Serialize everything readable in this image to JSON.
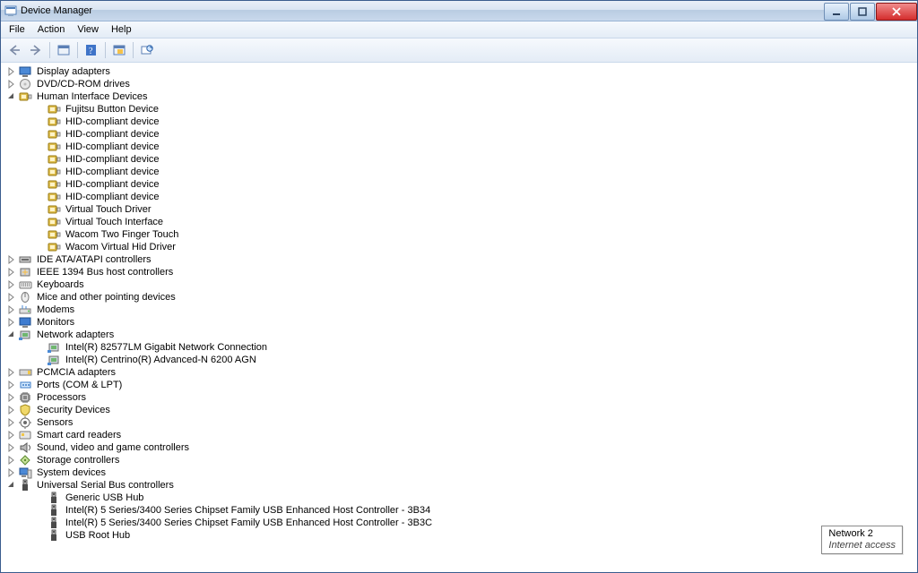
{
  "title": "Device Manager",
  "menu": [
    "File",
    "Action",
    "View",
    "Help"
  ],
  "tooltip": {
    "l1": "Network 2",
    "l2": "Internet access"
  },
  "tree": [
    {
      "d": 1,
      "exp": "closed",
      "icon": "display",
      "label": "Display adapters"
    },
    {
      "d": 1,
      "exp": "closed",
      "icon": "dvd",
      "label": "DVD/CD-ROM drives"
    },
    {
      "d": 1,
      "exp": "open",
      "icon": "hid",
      "label": "Human Interface Devices"
    },
    {
      "d": 2,
      "exp": "leaf",
      "icon": "hidi",
      "label": "Fujitsu Button Device"
    },
    {
      "d": 2,
      "exp": "leaf",
      "icon": "hidi",
      "label": "HID-compliant device"
    },
    {
      "d": 2,
      "exp": "leaf",
      "icon": "hidi",
      "label": "HID-compliant device"
    },
    {
      "d": 2,
      "exp": "leaf",
      "icon": "hidi",
      "label": "HID-compliant device"
    },
    {
      "d": 2,
      "exp": "leaf",
      "icon": "hidi",
      "label": "HID-compliant device"
    },
    {
      "d": 2,
      "exp": "leaf",
      "icon": "hidi",
      "label": "HID-compliant device"
    },
    {
      "d": 2,
      "exp": "leaf",
      "icon": "hidi",
      "label": "HID-compliant device"
    },
    {
      "d": 2,
      "exp": "leaf",
      "icon": "hidi",
      "label": "HID-compliant device"
    },
    {
      "d": 2,
      "exp": "leaf",
      "icon": "hidi",
      "label": "Virtual Touch Driver"
    },
    {
      "d": 2,
      "exp": "leaf",
      "icon": "hidi",
      "label": "Virtual Touch Interface"
    },
    {
      "d": 2,
      "exp": "leaf",
      "icon": "hidi",
      "label": "Wacom Two Finger Touch"
    },
    {
      "d": 2,
      "exp": "leaf",
      "icon": "hidi",
      "label": "Wacom Virtual Hid Driver"
    },
    {
      "d": 1,
      "exp": "closed",
      "icon": "ide",
      "label": "IDE ATA/ATAPI controllers"
    },
    {
      "d": 1,
      "exp": "closed",
      "icon": "ieee",
      "label": "IEEE 1394 Bus host controllers"
    },
    {
      "d": 1,
      "exp": "closed",
      "icon": "keyboard",
      "label": "Keyboards"
    },
    {
      "d": 1,
      "exp": "closed",
      "icon": "mouse",
      "label": "Mice and other pointing devices"
    },
    {
      "d": 1,
      "exp": "closed",
      "icon": "modem",
      "label": "Modems"
    },
    {
      "d": 1,
      "exp": "closed",
      "icon": "monitor",
      "label": "Monitors"
    },
    {
      "d": 1,
      "exp": "open",
      "icon": "net",
      "label": "Network adapters"
    },
    {
      "d": 2,
      "exp": "leaf",
      "icon": "neti",
      "label": "Intel(R) 82577LM Gigabit Network Connection"
    },
    {
      "d": 2,
      "exp": "leaf",
      "icon": "neti",
      "label": "Intel(R) Centrino(R) Advanced-N 6200 AGN"
    },
    {
      "d": 1,
      "exp": "closed",
      "icon": "pcmcia",
      "label": "PCMCIA adapters"
    },
    {
      "d": 1,
      "exp": "closed",
      "icon": "port",
      "label": "Ports (COM & LPT)"
    },
    {
      "d": 1,
      "exp": "closed",
      "icon": "cpu",
      "label": "Processors"
    },
    {
      "d": 1,
      "exp": "closed",
      "icon": "security",
      "label": "Security Devices"
    },
    {
      "d": 1,
      "exp": "closed",
      "icon": "sensor",
      "label": "Sensors"
    },
    {
      "d": 1,
      "exp": "closed",
      "icon": "smartcard",
      "label": "Smart card readers"
    },
    {
      "d": 1,
      "exp": "closed",
      "icon": "sound",
      "label": "Sound, video and game controllers"
    },
    {
      "d": 1,
      "exp": "closed",
      "icon": "storage",
      "label": "Storage controllers"
    },
    {
      "d": 1,
      "exp": "closed",
      "icon": "system",
      "label": "System devices"
    },
    {
      "d": 1,
      "exp": "open",
      "icon": "usb",
      "label": "Universal Serial Bus controllers"
    },
    {
      "d": 2,
      "exp": "leaf",
      "icon": "usbi",
      "label": "Generic USB Hub"
    },
    {
      "d": 2,
      "exp": "leaf",
      "icon": "usbi",
      "label": "Intel(R) 5 Series/3400 Series Chipset Family USB Enhanced Host Controller - 3B34"
    },
    {
      "d": 2,
      "exp": "leaf",
      "icon": "usbi",
      "label": "Intel(R) 5 Series/3400 Series Chipset Family USB Enhanced Host Controller - 3B3C"
    },
    {
      "d": 2,
      "exp": "leaf",
      "icon": "usbi",
      "label": "USB Root Hub"
    }
  ]
}
